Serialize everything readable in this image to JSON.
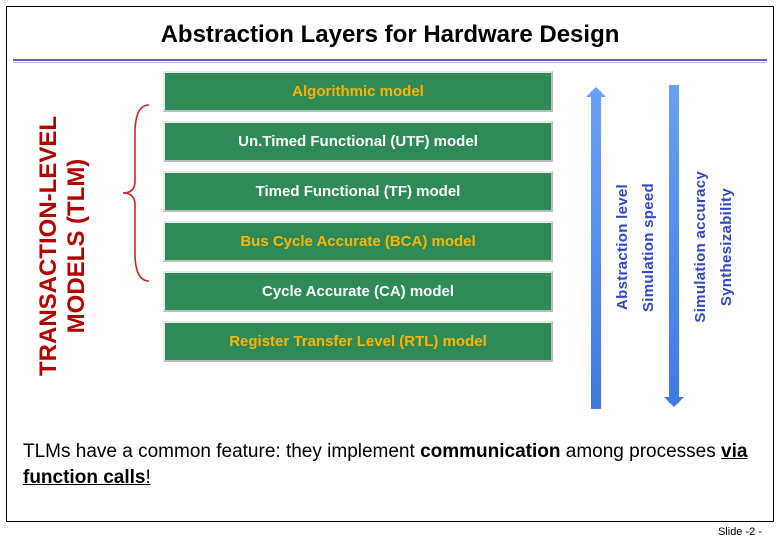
{
  "title": "Abstraction Layers for Hardware Design",
  "tlm_label": {
    "line1": "TRANSACTION-LEVEL",
    "line2": "MODELS (TLM)"
  },
  "models": [
    {
      "label": "Algorithmic model",
      "color": "orange"
    },
    {
      "label": "Un.Timed Functional (UTF) model",
      "color": "white"
    },
    {
      "label": "Timed Functional (TF) model",
      "color": "white"
    },
    {
      "label": "Bus Cycle Accurate (BCA) model",
      "color": "orange"
    },
    {
      "label": "Cycle Accurate (CA) model",
      "color": "white"
    },
    {
      "label": "Register Transfer Level (RTL) model",
      "color": "orange"
    }
  ],
  "right": {
    "up": [
      "Abstraction level",
      "Simulation speed"
    ],
    "down": [
      "Simulation accuracy",
      "Synthesizability"
    ]
  },
  "footer": {
    "pre": "TLMs have a common feature: they implement ",
    "bold1": "communication",
    "mid": " among processes ",
    "bold2": "via function calls",
    "post": "!"
  },
  "slide_number": "Slide -2 -"
}
